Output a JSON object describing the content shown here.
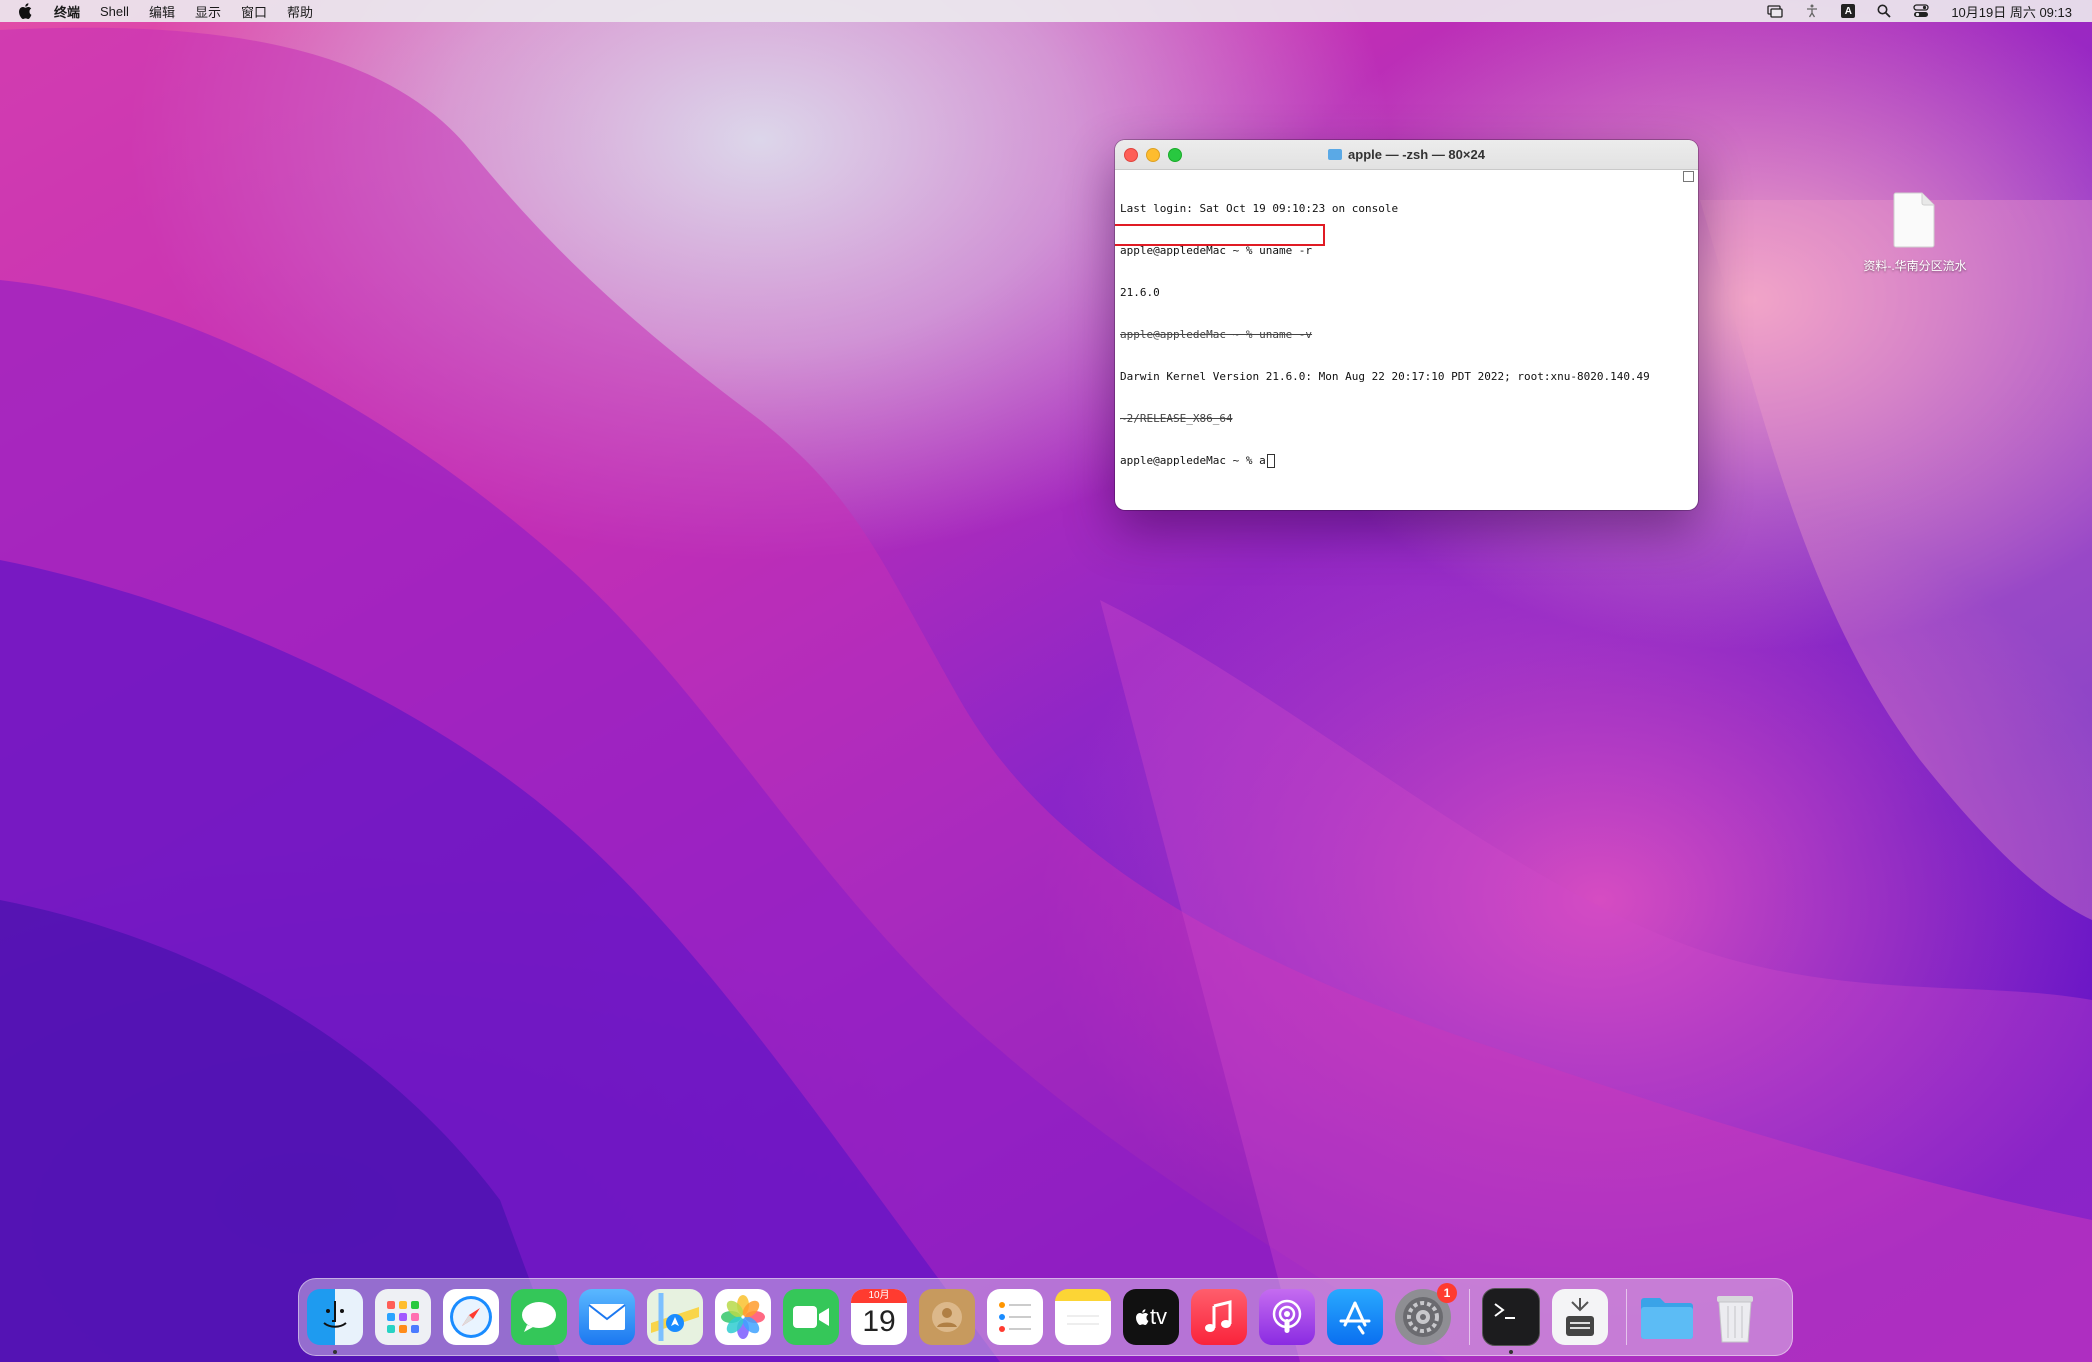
{
  "menubar": {
    "app_name": "终端",
    "menus": [
      "Shell",
      "编辑",
      "显示",
      "窗口",
      "帮助"
    ],
    "input_method": "A",
    "clock": "10月19日 周六  09:13"
  },
  "terminal": {
    "title": "apple — -zsh — 80×24",
    "lines": [
      "Last login: Sat Oct 19 09:10:23 on console",
      "apple@appledeMac ~ % uname -r",
      "21.6.0",
      "apple@appledeMac ~ % uname -v",
      "Darwin Kernel Version 21.6.0: Mon Aug 22 20:17:10 PDT 2022; root:xnu-8020.140.49",
      "~2/RELEASE_X86_64",
      "apple@appledeMac ~ % a"
    ]
  },
  "desktop": {
    "file_label": "资料-.华南分区流水"
  },
  "dock": {
    "calendar_month": "10月",
    "calendar_day": "19",
    "appletv_label": "tv",
    "settings_badge": "1",
    "items": [
      "finder-icon",
      "launchpad-icon",
      "safari-icon",
      "messages-icon",
      "mail-icon",
      "maps-icon",
      "photos-icon",
      "facetime-icon",
      "calendar-icon",
      "contacts-icon",
      "reminders-icon",
      "notes-icon",
      "appletv-icon",
      "music-icon",
      "podcasts-icon",
      "appstore-icon",
      "settings-icon",
      "terminal-icon",
      "screenshot-icon",
      "downloads-folder-icon",
      "trash-icon"
    ]
  },
  "colors": {
    "highlight_box": "#e01b24",
    "badge": "#ff3b30"
  }
}
